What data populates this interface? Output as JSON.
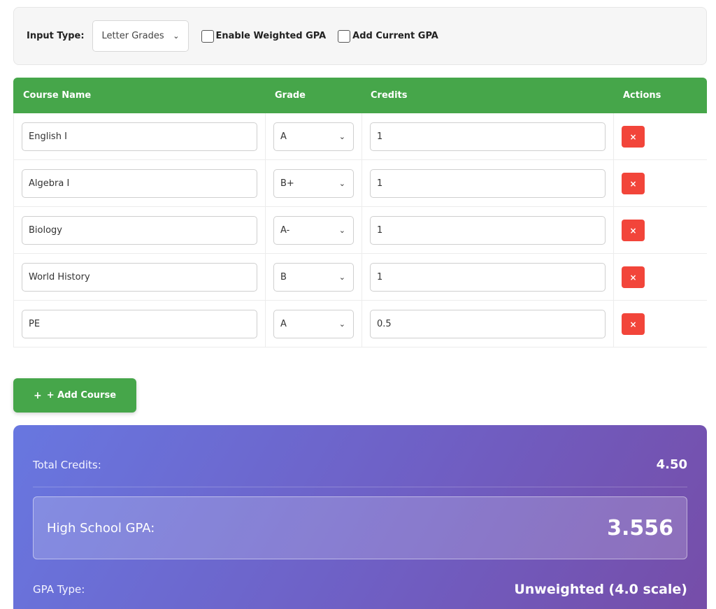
{
  "options": {
    "input_type_label": "Input Type:",
    "input_type_value": "Letter Grades",
    "weighted_label": "Enable Weighted GPA",
    "weighted_checked": false,
    "current_gpa_label": "Add Current GPA",
    "current_gpa_checked": false
  },
  "table": {
    "headers": {
      "course": "Course Name",
      "grade": "Grade",
      "credits": "Credits",
      "actions": "Actions"
    },
    "rows": [
      {
        "name": "English I",
        "grade": "A",
        "credits": "1"
      },
      {
        "name": "Algebra I",
        "grade": "B+",
        "credits": "1"
      },
      {
        "name": "Biology",
        "grade": "A-",
        "credits": "1"
      },
      {
        "name": "World History",
        "grade": "B",
        "credits": "1"
      },
      {
        "name": "PE",
        "grade": "A",
        "credits": "0.5"
      }
    ],
    "delete_label": "×"
  },
  "add_course": {
    "label": "+ Add Course",
    "icon": "+"
  },
  "results": {
    "total_credits_label": "Total Credits:",
    "total_credits_value": "4.50",
    "gpa_label": "High School GPA:",
    "gpa_value": "3.556",
    "gpa_type_label": "GPA Type:",
    "gpa_type_value": "Unweighted (4.0 scale)"
  },
  "colors": {
    "header_green": "#46a64a",
    "delete_red": "#f2453a",
    "gradient_start": "#6877e0",
    "gradient_end": "#764da8"
  }
}
